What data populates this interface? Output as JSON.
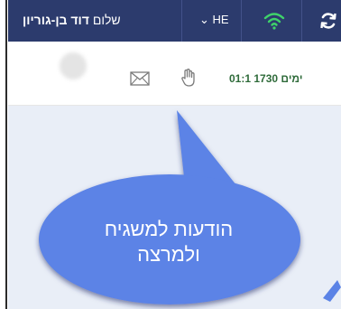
{
  "header": {
    "greeting": "שלום",
    "user_name": "דוד בן-גוריון",
    "language": "HE",
    "language_caret": "⌄"
  },
  "toolbar": {
    "days_text": "ימים 1730 01:1"
  },
  "callout": {
    "line1": "הודעות למשגיח",
    "line2": "ולמרצה"
  },
  "colors": {
    "topbar": "#2c3b6d",
    "wifi_green": "#3fd36a",
    "callout_blue": "#5b83e6"
  }
}
